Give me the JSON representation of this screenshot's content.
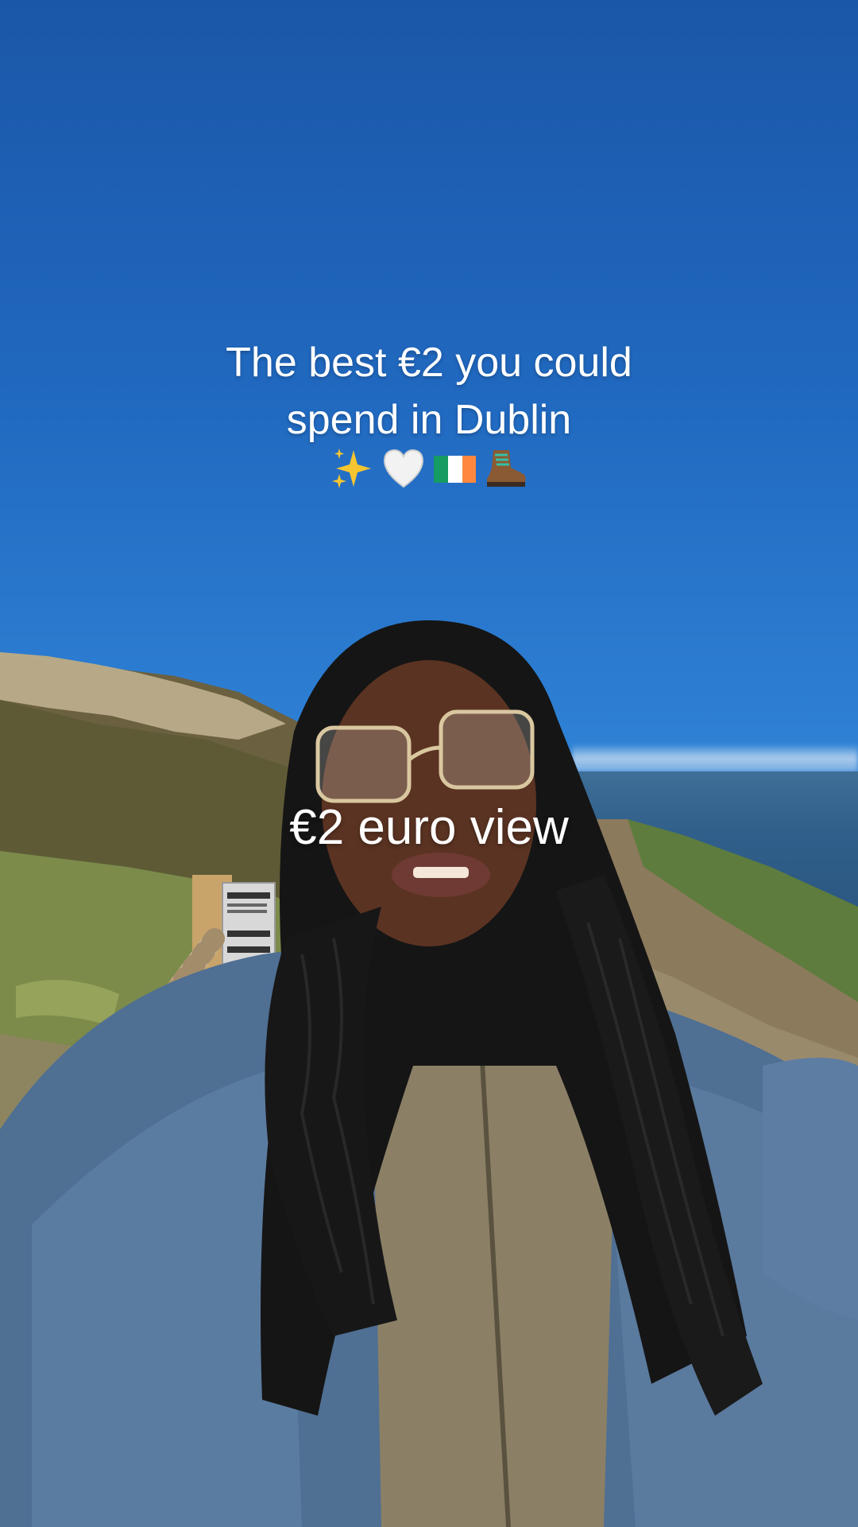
{
  "video": {
    "caption_line1": "The best €2 you could",
    "caption_line2": "spend in Dublin",
    "caption_emojis": [
      "sparkles-icon",
      "white-heart-icon",
      "ireland-flag-icon",
      "hiking-boot-icon"
    ],
    "overlay_text": "€2 euro view"
  },
  "colors": {
    "sky_top": "#1b57a8",
    "sky_bottom": "#86bdf0",
    "sea": "#2f5f8a",
    "text": "#ffffff"
  }
}
